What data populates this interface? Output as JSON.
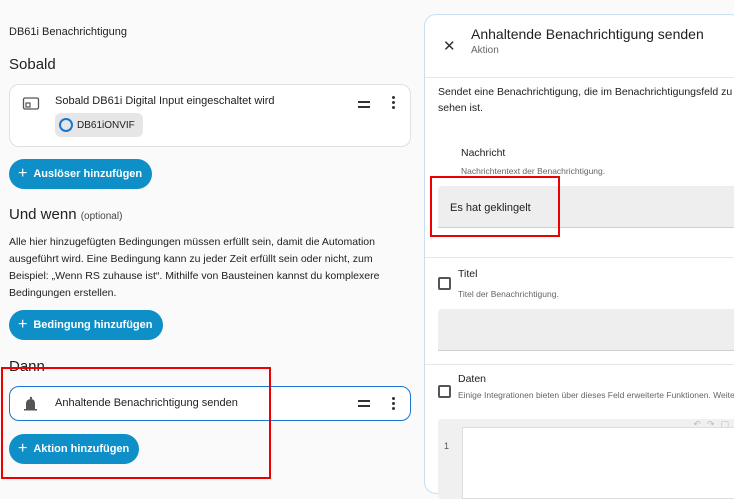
{
  "left": {
    "automation_title": "DB61i Benachrichtigung",
    "trigger_section": {
      "title": "Sobald"
    },
    "trigger_card": {
      "label": "Sobald DB61i Digital Input eingeschaltet wird",
      "chip": "DB61iONVIF",
      "icon": "switch-icon"
    },
    "add_trigger_label": "Auslöser hinzufügen",
    "condition_section": {
      "title": "Und wenn",
      "optional": "(optional)",
      "description": "Alle hier hinzugefügten Bedingungen müssen erfüllt sein, damit die Automation ausgeführt wird. Eine Bedingung kann zu jeder Zeit erfüllt sein oder nicht, zum Beispiel: „Wenn RS zuhause ist“. Mithilfe von Bausteinen kannst du komplexere Bedingungen erstellen."
    },
    "add_condition_label": "Bedingung hinzufügen",
    "action_section": {
      "title": "Dann"
    },
    "action_card": {
      "label": "Anhaltende Benachrichtigung senden",
      "icon": "bell-icon"
    },
    "add_action_label": "Aktion hinzufügen"
  },
  "panel": {
    "title": "Anhaltende Benachrichtigung senden",
    "subtitle": "Aktion",
    "description": "Sendet eine Benachrichtigung, die im Benachrichtigungsfeld zu sehen ist.",
    "fields": {
      "message": {
        "label": "Nachricht",
        "helper": "Nachrichtentext der Benachrichtigung.",
        "value": "Es hat geklingelt"
      },
      "title": {
        "label": "Titel",
        "helper": "Titel der Benachrichtigung.",
        "value": ""
      },
      "data": {
        "label": "Daten",
        "helper": "Einige Integrationen bieten über dieses Feld erweiterte Funktionen. Weitere Informationen findest du in der Integrationsdokumentation."
      }
    },
    "code_line_number": "1"
  },
  "colors": {
    "accent": "#0f8fc7",
    "highlight_box": "#e00000"
  }
}
